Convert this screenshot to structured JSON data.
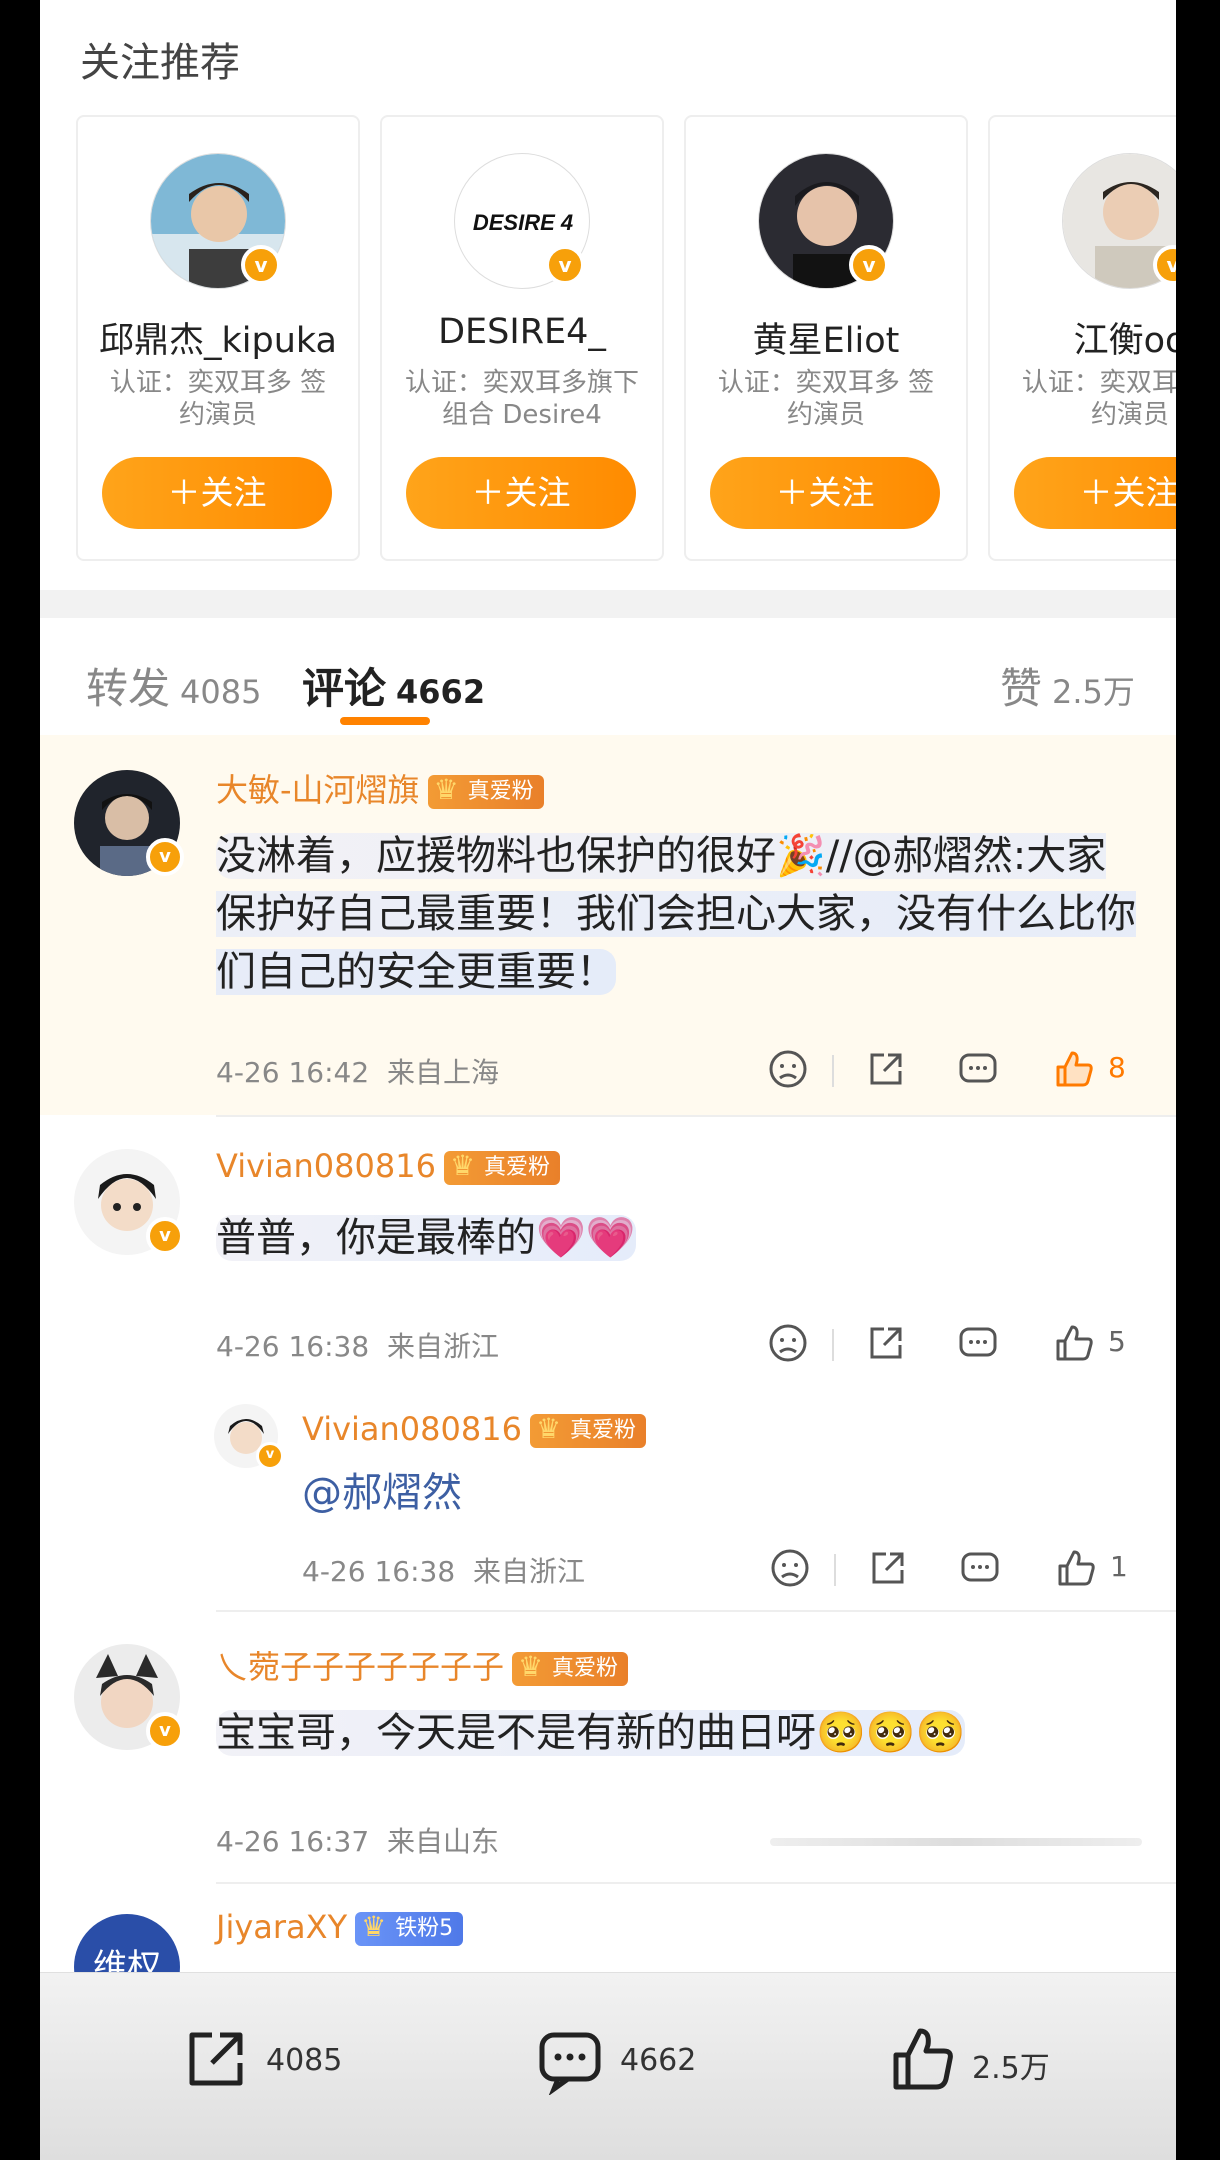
{
  "recommend": {
    "title": "关注推荐",
    "cards": [
      {
        "name": "邱鼎杰_kipuka",
        "desc": "认证：奕双耳多 签约演员",
        "follow": "＋关注",
        "badge": "v"
      },
      {
        "name": "DESIRE4_",
        "desc": "认证：奕双耳多旗下组合 Desire4",
        "follow": "＋关注",
        "badge": "v",
        "logo": "DESIRE 4"
      },
      {
        "name": "黄星Eliot",
        "desc": "认证：奕双耳多 签约演员",
        "follow": "＋关注",
        "badge": "v"
      },
      {
        "name": "江衡oo",
        "desc": "认证：奕双耳多 签约演员",
        "follow": "＋关注",
        "badge": "v"
      }
    ]
  },
  "tabs": {
    "repost_label": "转发",
    "repost_count": "4085",
    "comment_label": "评论",
    "comment_count": "4662",
    "like_label": "赞",
    "like_count": "2.5万"
  },
  "comments": [
    {
      "name": "大敏-山河熠旗",
      "badge": "真爱粉",
      "text": "没淋着，应援物料也保护的很好🎉//@郝熠然:大家保护好自己最重要！我们会担心大家，没有什么比你们自己的安全更重要！",
      "time": "4-26 16:42",
      "location": "来自上海",
      "likes": "8"
    },
    {
      "name": "Vivian080816",
      "badge": "真爱粉",
      "text": "普普，你是最棒的💗💗",
      "time": "4-26 16:38",
      "location": "来自浙江",
      "likes": "5"
    },
    {
      "name": "Vivian080816",
      "badge": "真爱粉",
      "text": "@郝熠然",
      "time": "4-26 16:38",
      "location": "来自浙江",
      "likes": "1"
    },
    {
      "name": "乀菀子子子子子子子",
      "badge": "真爱粉",
      "text": "宝宝哥，今天是不是有新的曲日呀🥺🥺🥺",
      "time": "4-26 16:37",
      "location": "来自山东",
      "likes": ""
    },
    {
      "name": "JiyaraXY",
      "badge": "铁粉5",
      "avatar_text": "维权"
    }
  ],
  "bottom_bar": {
    "repost": "4085",
    "comment": "4662",
    "like": "2.5万"
  },
  "colors": {
    "accent": "#ff8200",
    "name": "#e8862a",
    "badge_orange": "#f39b35",
    "badge_blue": "#5b84ef"
  },
  "icons": [
    "verified-icon",
    "angry-face-icon",
    "share-icon",
    "comment-icon",
    "thumbs-up-icon"
  ]
}
